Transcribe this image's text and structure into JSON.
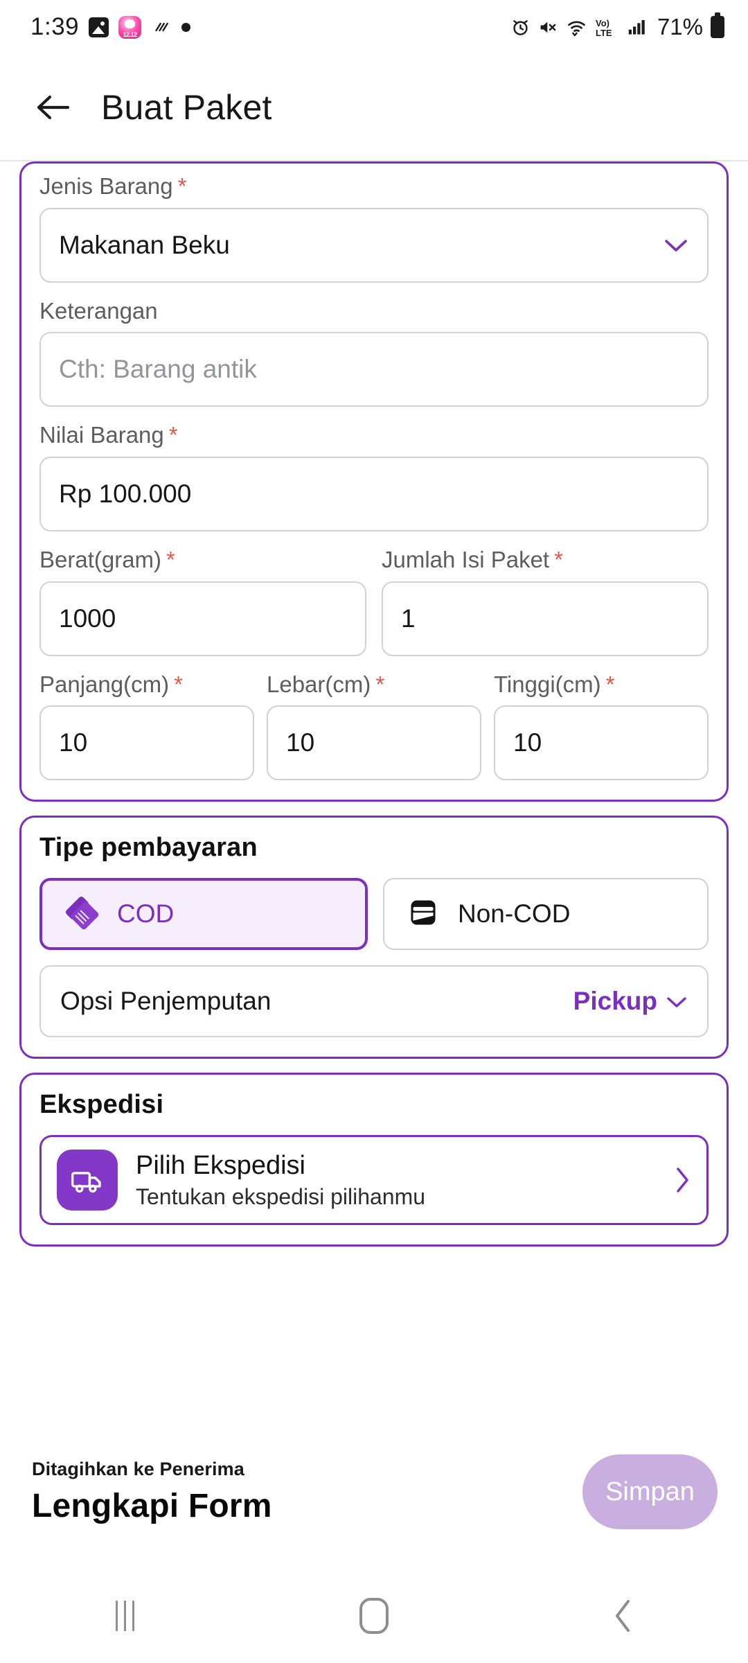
{
  "statusbar": {
    "time": "1:39",
    "battery_percent": "71%",
    "icons_left": [
      "photos-icon",
      "shopee-promo-icon",
      "snow-icon",
      "dot-icon"
    ],
    "icons_right": [
      "alarm-icon",
      "mute-icon",
      "wifi-icon",
      "volte-icon",
      "signal-icon",
      "battery-icon"
    ]
  },
  "appbar": {
    "back_icon": "back-arrow-icon",
    "title": "Buat Paket"
  },
  "form": {
    "jenis_barang": {
      "label": "Jenis Barang",
      "required": "*",
      "value": "Makanan Beku",
      "chevron": "chevron-down-icon"
    },
    "keterangan": {
      "label": "Keterangan",
      "required": "",
      "placeholder": "Cth: Barang antik",
      "value": ""
    },
    "nilai_barang": {
      "label": "Nilai Barang",
      "required": "*",
      "value": "Rp 100.000"
    },
    "berat": {
      "label": "Berat(gram)",
      "required": "*",
      "value": "1000"
    },
    "jumlah_isi": {
      "label": "Jumlah Isi Paket",
      "required": "*",
      "value": "1"
    },
    "panjang": {
      "label": "Panjang(cm)",
      "required": "*",
      "value": "10"
    },
    "lebar": {
      "label": "Lebar(cm)",
      "required": "*",
      "value": "10"
    },
    "tinggi": {
      "label": "Tinggi(cm)",
      "required": "*",
      "value": "10"
    }
  },
  "payment": {
    "title": "Tipe pembayaran",
    "options": [
      {
        "label": "COD",
        "icon": "handshake-icon",
        "selected": true
      },
      {
        "label": "Non-COD",
        "icon": "wallet-icon",
        "selected": false
      }
    ],
    "pickup": {
      "label": "Opsi Penjemputan",
      "value": "Pickup",
      "chevron": "chevron-down-icon"
    }
  },
  "ekspedisi": {
    "title": "Ekspedisi",
    "row": {
      "icon": "truck-icon",
      "title": "Pilih Ekspedisi",
      "subtitle": "Tentukan ekspedisi pilihanmu",
      "chevron": "chevron-right-icon"
    }
  },
  "bottombar": {
    "billed_to": "Ditagihkan ke Penerima",
    "status": "Lengkapi Form",
    "save_label": "Simpan"
  },
  "navbar": {
    "recents": "recents-icon",
    "home": "home-icon",
    "back": "back-icon"
  },
  "colors": {
    "primary_purple": "#7b2fbe",
    "tile_purple": "#8438c8",
    "selected_fill": "#f6eefc",
    "disabled_button": "#c9aee0",
    "required_red": "#e0594b"
  }
}
